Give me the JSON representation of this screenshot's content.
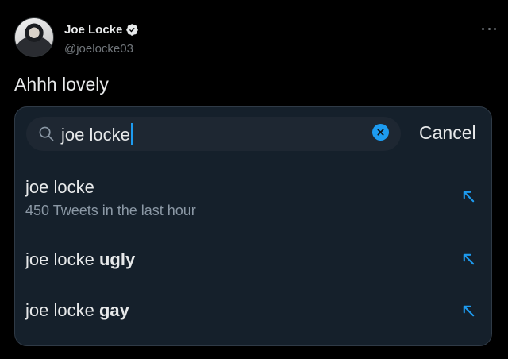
{
  "tweet": {
    "name": "Joe Locke",
    "handle": "@joelocke03",
    "text": "Ahhh lovely"
  },
  "search": {
    "value": "joe locke",
    "cancel_label": "Cancel"
  },
  "suggestions": [
    {
      "base": "joe locke ",
      "bold": "",
      "subtitle": "450 Tweets in the last hour"
    },
    {
      "base": "joe locke ",
      "bold": "ugly",
      "subtitle": ""
    },
    {
      "base": "joe locke ",
      "bold": "gay",
      "subtitle": ""
    }
  ],
  "colors": {
    "background": "#000000",
    "card": "#15202b",
    "accent": "#1d9bf0",
    "muted": "#71767b"
  },
  "icons": [
    "verified-badge-icon",
    "more-options-icon",
    "search-icon",
    "clear-icon",
    "autofill-arrow-icon"
  ]
}
